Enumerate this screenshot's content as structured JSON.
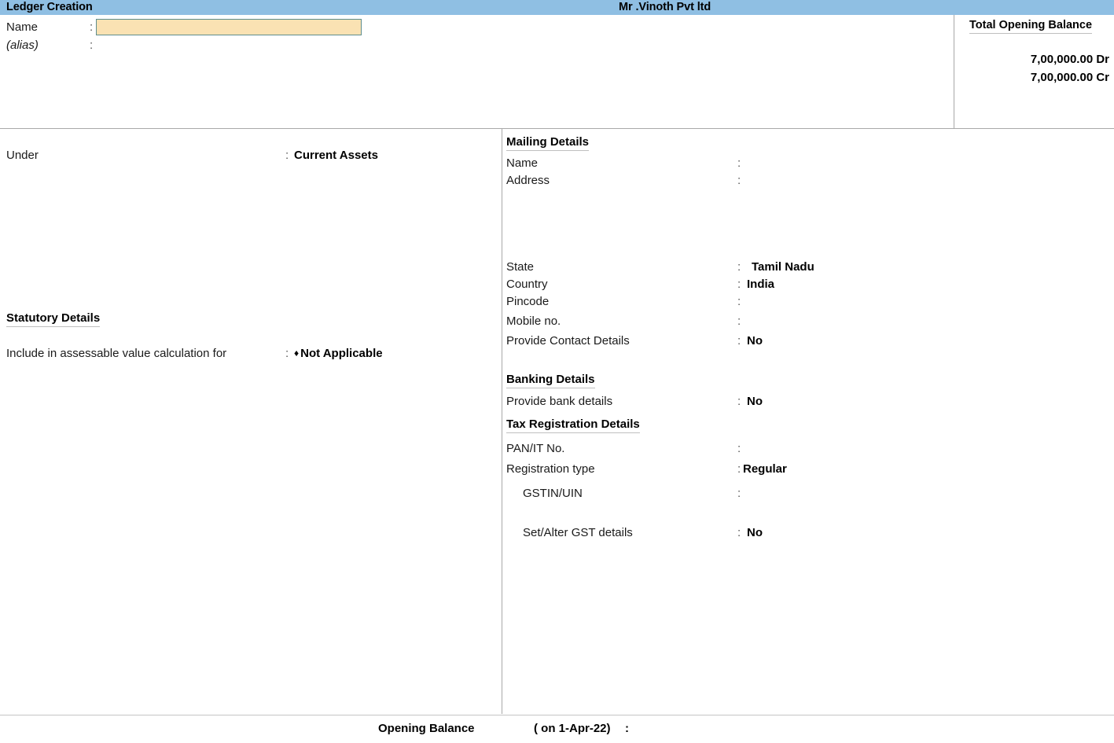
{
  "titlebar": {
    "screen_title": "Ledger Creation",
    "company_name": "Mr .Vinoth  Pvt ltd",
    "background_color": "#8fbfe3"
  },
  "identification": {
    "name_label": "Name",
    "name_value": "",
    "name_colon": ":",
    "alias_label": "(alias)",
    "alias_value": "",
    "alias_colon": ":",
    "input_fill_color": "#fae2b3",
    "input_border_color": "#5e8e8e"
  },
  "total_opening_balance": {
    "heading": "Total Opening Balance",
    "debit": "7,00,000.00 Dr",
    "credit": "7,00,000.00 Cr"
  },
  "left_panel": {
    "under": {
      "label": "Under",
      "colon": ":",
      "value": "Current Assets"
    },
    "statutory_heading": "Statutory Details",
    "assessable": {
      "label": "Include in assessable value calculation for",
      "colon": ":",
      "marker": "♦",
      "value": "Not Applicable"
    }
  },
  "right_panel": {
    "mailing_details": {
      "heading": "Mailing Details",
      "rows": [
        {
          "label": "Name",
          "colon": ":",
          "value": ""
        },
        {
          "label": "Address",
          "colon": ":",
          "value": ""
        },
        {
          "label": "State",
          "colon": ":",
          "value": "Tamil Nadu"
        },
        {
          "label": "Country",
          "colon": ":",
          "value": "India"
        },
        {
          "label": "Pincode",
          "colon": ":",
          "value": ""
        },
        {
          "label": "Mobile no.",
          "colon": ":",
          "value": ""
        },
        {
          "label": "Provide Contact Details",
          "colon": ":",
          "value": "No"
        }
      ]
    },
    "banking_details": {
      "heading": "Banking Details",
      "rows": [
        {
          "label": "Provide bank details",
          "colon": ":",
          "value": "No"
        }
      ]
    },
    "tax_registration_details": {
      "heading": "Tax Registration Details",
      "rows": [
        {
          "label": "PAN/IT No.",
          "colon": ":",
          "value": ""
        },
        {
          "label": "Registration type",
          "colon": ":",
          "value": "Regular"
        },
        {
          "label": "GSTIN/UIN",
          "colon": ":",
          "value": ""
        },
        {
          "label": "Set/Alter GST details",
          "colon": ":",
          "value": "No"
        }
      ]
    }
  },
  "footer": {
    "opening_balance_label": "Opening Balance",
    "as_on": "( on 1-Apr-22)",
    "colon": ":",
    "value": ""
  }
}
